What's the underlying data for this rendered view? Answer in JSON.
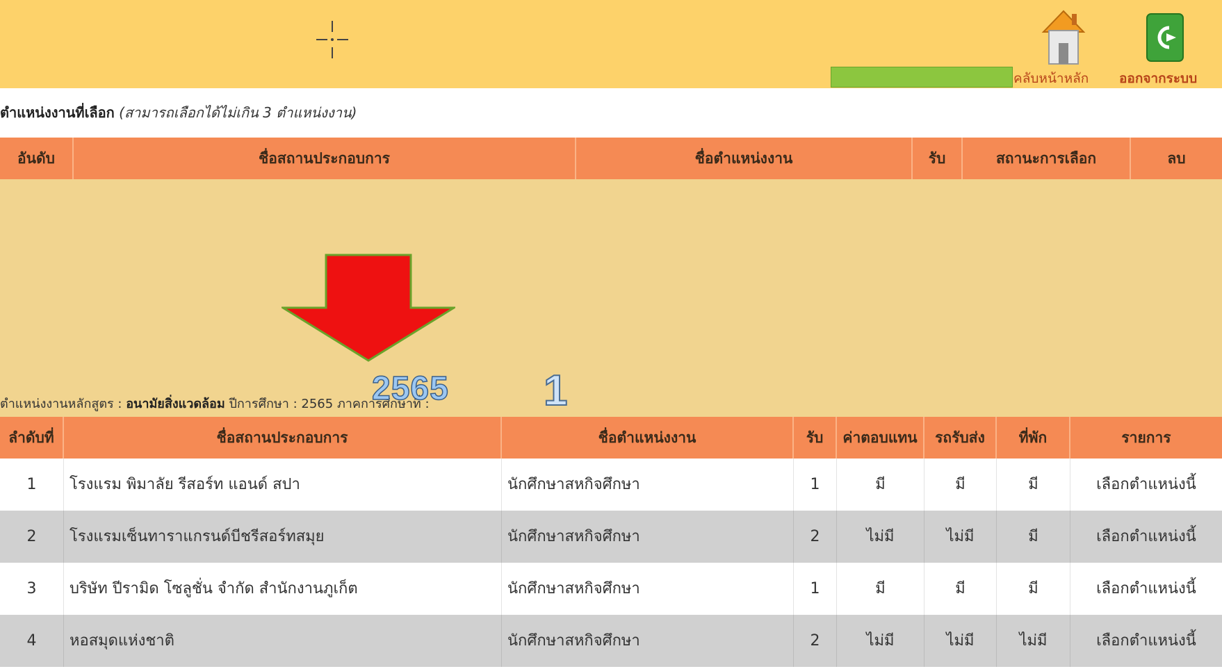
{
  "header": {
    "nav_home": "คลับหน้าหลัก",
    "nav_logout": "ออกจากระบบ",
    "home_icon": "home-icon",
    "exit_icon": "exit-icon"
  },
  "selected": {
    "caption_title": "ตำแหน่งงานที่เลือก",
    "caption_note": "(สามารถเลือกได้ไม่เกิน 3 ตำแหน่งงาน)",
    "columns": [
      "อันดับ",
      "ชื่อสถานประกอบการ",
      "ชื่อตำแหน่งงาน",
      "รับ",
      "สถานะการเลือก",
      "ลบ"
    ]
  },
  "jobs": {
    "caption_prefix": "ตำแหน่งงานหลักสูตร :",
    "program": "อนามัยสิ่งแวดล้อม",
    "year_label": "ปีการศึกษา :",
    "year_value": "2565",
    "term_label": "ภาคการศึกษาที่ :",
    "overlay_year": "2565",
    "overlay_term": "1",
    "columns": [
      "ลำดับที่",
      "ชื่อสถานประกอบการ",
      "ชื่อตำแหน่งงาน",
      "รับ",
      "ค่าตอบแทน",
      "รถรับส่ง",
      "ที่พัก",
      "รายการ"
    ],
    "rows": [
      {
        "no": "1",
        "company": "โรงแรม พิมาลัย รีสอร์ท แอนด์ สปา",
        "position": "นักศึกษาสหกิจศึกษา",
        "accept": "1",
        "pay": "มี",
        "shuttle": "มี",
        "lodging": "มี",
        "action": "เลือกตำแหน่งนี้"
      },
      {
        "no": "2",
        "company": "โรงแรมเซ็นทาราแกรนด์บีชรีสอร์ทสมุย",
        "position": "นักศึกษาสหกิจศึกษา",
        "accept": "2",
        "pay": "ไม่มี",
        "shuttle": "ไม่มี",
        "lodging": "มี",
        "action": "เลือกตำแหน่งนี้"
      },
      {
        "no": "3",
        "company": "บริษัท ปีรามิด โซลูชั่น จำกัด สำนักงานภูเก็ต",
        "position": "นักศึกษาสหกิจศึกษา",
        "accept": "1",
        "pay": "มี",
        "shuttle": "มี",
        "lodging": "มี",
        "action": "เลือกตำแหน่งนี้"
      },
      {
        "no": "4",
        "company": "หอสมุดแห่งชาติ",
        "position": "นักศึกษาสหกิจศึกษา",
        "accept": "2",
        "pay": "ไม่มี",
        "shuttle": "ไม่มี",
        "lodging": "ไม่มี",
        "action": "เลือกตำแหน่งนี้"
      }
    ]
  }
}
